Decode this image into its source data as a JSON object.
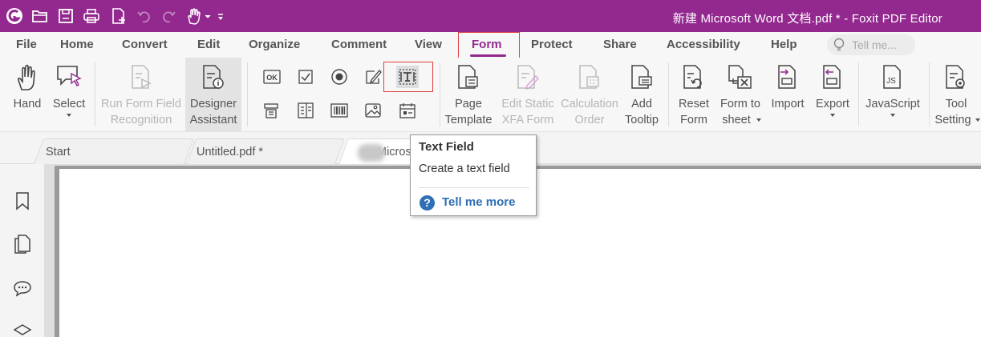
{
  "window": {
    "title": "新建 Microsoft Word 文档.pdf * - Foxit PDF Editor",
    "accent_color": "#93288f"
  },
  "quick_access": [
    {
      "name": "foxit-logo-icon"
    },
    {
      "name": "open-icon"
    },
    {
      "name": "save-icon"
    },
    {
      "name": "print-icon"
    },
    {
      "name": "new-icon"
    },
    {
      "name": "undo-icon"
    },
    {
      "name": "redo-icon"
    },
    {
      "name": "hand-tool-icon"
    },
    {
      "name": "customize-icon"
    }
  ],
  "menu": {
    "items": [
      "File",
      "Home",
      "Convert",
      "Edit",
      "Organize",
      "Comment",
      "View",
      "Form",
      "Protect",
      "Share",
      "Accessibility",
      "Help"
    ],
    "active": "Form",
    "tell_me_placeholder": "Tell me..."
  },
  "ribbon": {
    "hand": "Hand",
    "select": "Select",
    "run_form_field_1": "Run Form Field",
    "run_form_field_2": "Recognition",
    "designer_1": "Designer",
    "designer_2": "Assistant",
    "page_template_1": "Page",
    "page_template_2": "Template",
    "edit_static_1": "Edit Static",
    "edit_static_2": "XFA Form",
    "calc_order_1": "Calculation",
    "calc_order_2": "Order",
    "add_tooltip_1": "Add",
    "add_tooltip_2": "Tooltip",
    "reset_form_1": "Reset",
    "reset_form_2": "Form",
    "form_to_sheet_1": "Form to",
    "form_to_sheet_2": "sheet",
    "import": "Import",
    "export": "Export",
    "javascript": "JavaScript",
    "tool_setting_1": "Tool",
    "tool_setting_2": "Setting",
    "push_button_icon_text": "OK"
  },
  "tabs": [
    {
      "label": "Start"
    },
    {
      "label": "Untitled.pdf *"
    },
    {
      "label": "Microso"
    }
  ],
  "tooltip": {
    "title": "Text Field",
    "description": "Create a text field",
    "link": "Tell me more"
  }
}
